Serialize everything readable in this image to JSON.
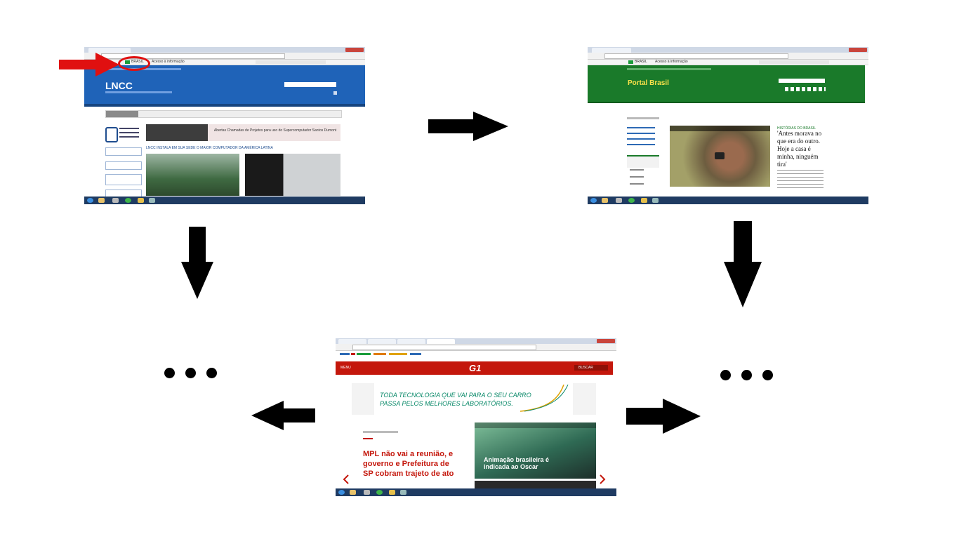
{
  "screens": {
    "lncc": {
      "gov_label": "BRASIL",
      "gov_link": "Acesso à informação",
      "site_title": "LNCC",
      "headline": "LNCC INSTALA EM SUA SEDE O MAIOR COMPUTADOR DA AMÉRICA LATINA",
      "banner": "Abertas Chamadas de Projetos para uso do Supercomputador Santos Dumont"
    },
    "portal": {
      "gov_label": "BRASIL",
      "gov_link": "Acesso à informação",
      "site_title": "Portal Brasil",
      "story_kicker": "HISTÓRIAS DO BRASIL",
      "story_title": "'Antes morava no que era do outro. Hoje a casa é minha, ninguém tira'"
    },
    "g1": {
      "logo": "G1",
      "menu": "MENU",
      "search": "BUSCAR",
      "ad_line1": "TODA TECNOLOGIA QUE VAI PARA O SEU CARRO",
      "ad_line2": "PASSA PELOS MELHORES LABORATÓRIOS.",
      "headline": "MPL não vai a reunião, e governo e Prefeitura de SP cobram trajeto de ato",
      "card_title": "Animação brasileira é indicada ao Oscar"
    }
  },
  "colors": {
    "lncc_blue": "#1f63b8",
    "portal_green": "#1a7a2a",
    "g1_red": "#c4170c",
    "highlight_red": "#e01010"
  },
  "icons": [
    "right-arrow-icon",
    "down-arrow-icon",
    "left-arrow-icon",
    "red-pointer-arrow-icon",
    "ellipsis-icon"
  ]
}
